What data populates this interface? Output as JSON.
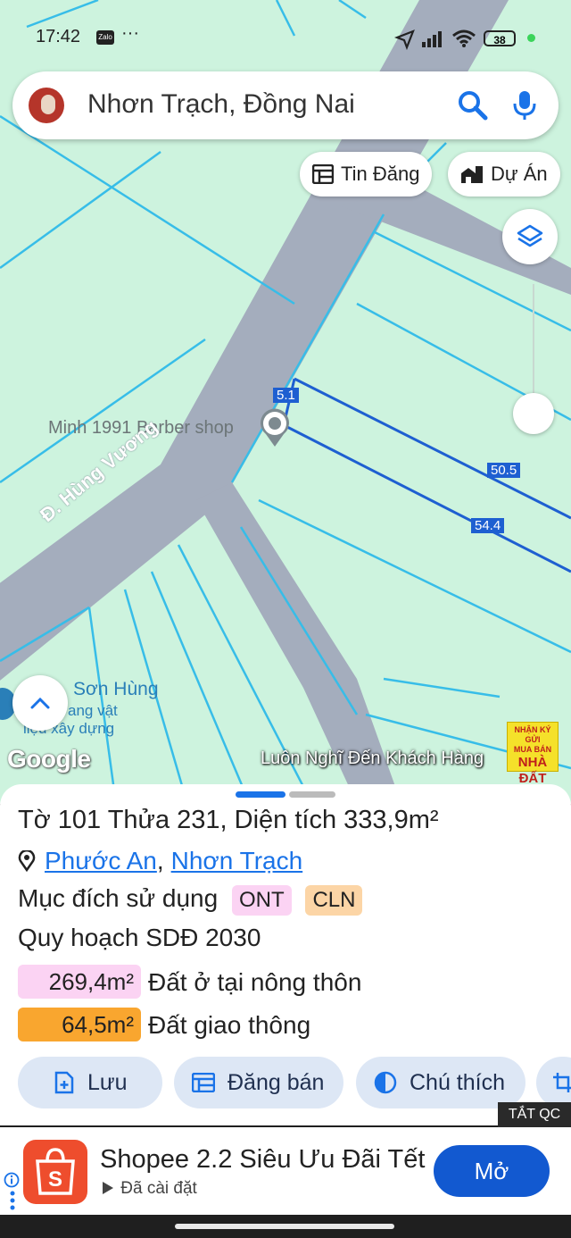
{
  "status": {
    "time": "17:42",
    "zalo": "Zalo",
    "more": "···",
    "battery": "38"
  },
  "search": {
    "query": "Nhơn Trạch, Đồng Nai"
  },
  "chips": {
    "listings": "Tin Đăng",
    "projects": "Dự Án"
  },
  "map": {
    "poi_barber": "Minh 1991 Barber shop",
    "road_name": "Đ. Hùng Vương",
    "poi_store": "Sơn Hùng",
    "poi_store_sub1": "ang vật",
    "poi_store_sub2": "liệu xây dựng",
    "dim1": "5.1",
    "dim2": "50.5",
    "dim3": "54.4",
    "google": "Google",
    "brand_slogan": "Luôn Nghĩ Đến Khách Hàng",
    "brand_logo_line1": "NHẬN KÝ GỬI",
    "brand_logo_line2": "MUA BÁN",
    "brand_logo_line3": "NHÀ ĐẤT"
  },
  "parcel": {
    "title": "Tờ 101 Thửa 231, Diện tích 333,9m²",
    "ward": "Phước An",
    "separator": ",",
    "district": "Nhơn Trạch",
    "usage_label": "Mục đích sử dụng",
    "usage_tags": [
      "ONT",
      "CLN"
    ],
    "plan_label": "Quy hoạch SDĐ 2030",
    "areas": [
      {
        "value": "269,4m²",
        "label": "Đất ở tại nông thôn",
        "color": "#fbd3f3"
      },
      {
        "value": "64,5m²",
        "label": "Đất giao thông",
        "color": "#f9a62f"
      }
    ]
  },
  "actions": {
    "save": "Lưu",
    "post": "Đăng bán",
    "legend": "Chú thích"
  },
  "ad": {
    "close": "TẮT QC",
    "title": "Shopee 2.2 Siêu Ưu Đãi Tết",
    "subtitle": "Đã cài đặt",
    "cta": "Mở"
  },
  "colors": {
    "parcel_line": "#1e5fd1",
    "cadastral": "#37bde8",
    "road": "#a4adbd",
    "map_bg": "#cdf3de"
  }
}
